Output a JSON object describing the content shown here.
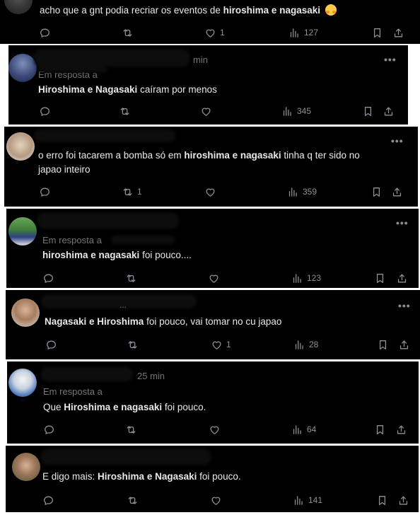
{
  "tweets": [
    {
      "time": "",
      "reply_label": "",
      "text_pre": "acho que a gnt podia recriar os eventos de ",
      "text_bold": "hiroshima e nagasaki",
      "text_post": " ",
      "text_line2": "",
      "reply_count": "",
      "retweet_count": "",
      "like_count": "1",
      "view_count": "127"
    },
    {
      "time": "min",
      "reply_label": "Em resposta a",
      "text_pre": "",
      "text_bold": "Hiroshima e Nagasaki",
      "text_post": " caíram por menos",
      "text_line2": "",
      "reply_count": "",
      "retweet_count": "",
      "like_count": "",
      "view_count": "345"
    },
    {
      "time": "",
      "reply_label": "",
      "text_pre": "o erro foi tacarem a bomba só em ",
      "text_bold": "hiroshima e nagasaki",
      "text_post": " tinha q ter sido no",
      "text_line2": "japao inteiro",
      "reply_count": "",
      "retweet_count": "1",
      "like_count": "",
      "view_count": "359"
    },
    {
      "time": "",
      "reply_label": "Em resposta a",
      "text_pre": "",
      "text_bold": "hiroshima e nagasaki",
      "text_post": " foi pouco....",
      "text_line2": "",
      "reply_count": "",
      "retweet_count": "",
      "like_count": "",
      "view_count": "123"
    },
    {
      "time": "",
      "reply_label": "",
      "text_pre": "",
      "text_bold": "Nagasaki e Hiroshima",
      "text_post": " foi pouco, vai tomar no cu japao",
      "text_line2": "",
      "reply_count": "",
      "retweet_count": "",
      "like_count": "1",
      "view_count": "28"
    },
    {
      "time": "25 min",
      "reply_label": "Em resposta a",
      "text_pre": "Que ",
      "text_bold": "Hiroshima e nagasaki",
      "text_post": " foi pouco.",
      "text_line2": "",
      "reply_count": "",
      "retweet_count": "",
      "like_count": "",
      "view_count": "64"
    },
    {
      "time": "",
      "reply_label": "",
      "text_pre": "E digo mais: ",
      "text_bold": "Hiroshima e Nagasaki",
      "text_post": " foi pouco.",
      "text_line2": "",
      "reply_count": "",
      "retweet_count": "",
      "like_count": "",
      "view_count": "141"
    }
  ],
  "more_label": "•••",
  "icons": {
    "reply": "reply-icon",
    "retweet": "retweet-icon",
    "like": "heart-icon",
    "views": "views-icon",
    "bookmark": "bookmark-icon",
    "share": "share-icon",
    "emoji": "smiling-face-with-hearts-emoji"
  },
  "colors": {
    "card_bg": "#000000",
    "text": "#e7e9ea",
    "muted": "#71767b",
    "page_bg": "#ffffff"
  }
}
